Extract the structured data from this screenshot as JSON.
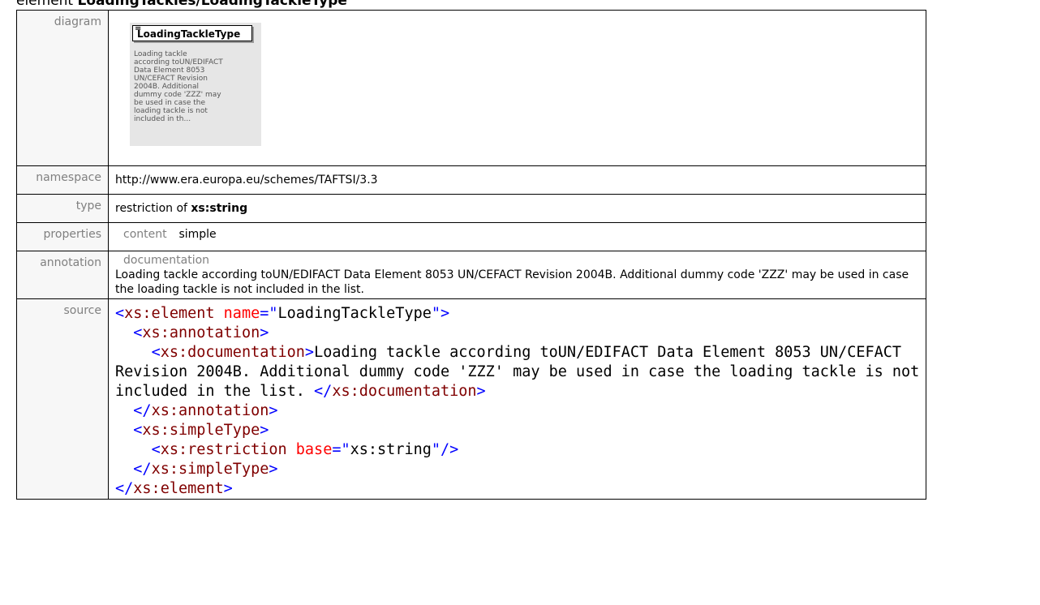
{
  "heading": {
    "prefix": "element",
    "name": "LoadingTackles/LoadingTackleType"
  },
  "rows": {
    "diagram": {
      "label": "diagram",
      "box_title": "LoadingTackleType",
      "box_description": "Loading tackle according toUN/EDIFACT Data Element 8053 UN/CEFACT Revision 2004B. Additional dummy code 'ZZZ' may be used in case the loading tackle is not included in th..."
    },
    "namespace": {
      "label": "namespace",
      "value": "http://www.era.europa.eu/schemes/TAFTSI/3.3"
    },
    "type": {
      "label": "type",
      "prefix": "restriction of",
      "base": "xs:string"
    },
    "properties": {
      "label": "properties",
      "key": "content",
      "value": "simple"
    },
    "annotation": {
      "label": "annotation",
      "key": "documentation",
      "text": "Loading tackle according toUN/EDIFACT Data Element 8053 UN/CEFACT Revision 2004B. Additional dummy code 'ZZZ' may be used in case the loading tackle is not included in the list."
    },
    "source": {
      "label": "source",
      "element_tag": "xs:element",
      "name_attr": "name",
      "name_value": "LoadingTackleType",
      "annotation_tag": "xs:annotation",
      "documentation_tag": "xs:documentation",
      "documentation_text": "Loading tackle according toUN/EDIFACT Data Element 8053 UN/CEFACT Revision 2004B. Additional dummy code 'ZZZ' may be used in case the loading tackle is not included in the list. ",
      "simpletype_tag": "xs:simpleType",
      "restriction_tag": "xs:restriction",
      "base_attr": "base",
      "base_value": "xs:string"
    }
  },
  "colors": {
    "tag_bracket": "#0000ff",
    "tag_name": "#800000",
    "attr_name": "#ff0000",
    "attr_value": "#0000ff",
    "label_text": "#808080",
    "label_bg": "#f7f7f7",
    "diagram_bg": "#e6e6e6"
  }
}
